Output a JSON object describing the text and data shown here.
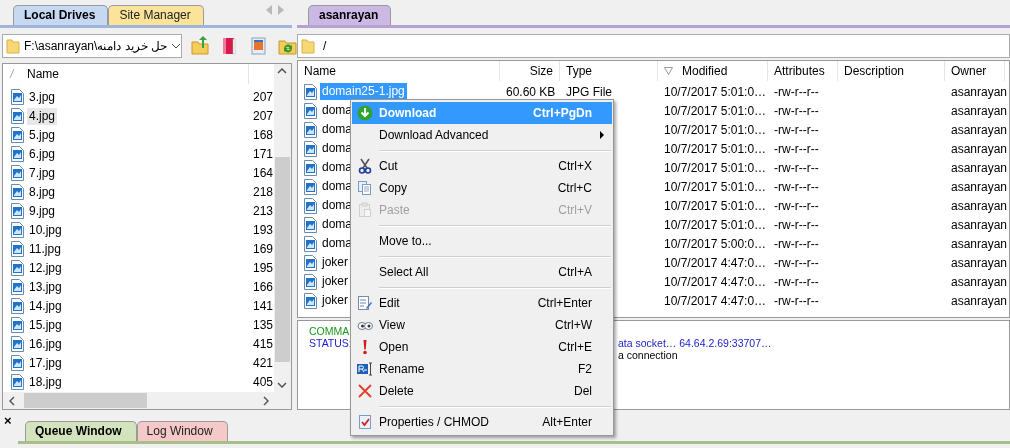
{
  "local": {
    "tabs": [
      {
        "label": "Local Drives",
        "selected": true,
        "color": "#c6d8f2"
      },
      {
        "label": "Site Manager",
        "selected": false,
        "color": "#fbe39a"
      }
    ],
    "path": "F:\\asanrayan\\حل خرید دامنه",
    "columns": [
      "Name"
    ],
    "files": [
      {
        "name": "3.jpg",
        "size": "207",
        "selected": false
      },
      {
        "name": "4.jpg",
        "size": "207",
        "selected": true
      },
      {
        "name": "5.jpg",
        "size": "168",
        "selected": false
      },
      {
        "name": "6.jpg",
        "size": "171",
        "selected": false
      },
      {
        "name": "7.jpg",
        "size": "164",
        "selected": false
      },
      {
        "name": "8.jpg",
        "size": "218",
        "selected": false
      },
      {
        "name": "9.jpg",
        "size": "213",
        "selected": false
      },
      {
        "name": "10.jpg",
        "size": "193",
        "selected": false
      },
      {
        "name": "11.jpg",
        "size": "169",
        "selected": false
      },
      {
        "name": "12.jpg",
        "size": "195",
        "selected": false
      },
      {
        "name": "13.jpg",
        "size": "166",
        "selected": false
      },
      {
        "name": "14.jpg",
        "size": "141",
        "selected": false
      },
      {
        "name": "15.jpg",
        "size": "135",
        "selected": false
      },
      {
        "name": "16.jpg",
        "size": "415",
        "selected": false
      },
      {
        "name": "17.jpg",
        "size": "421",
        "selected": false
      },
      {
        "name": "18.jpg",
        "size": "405",
        "selected": false
      }
    ]
  },
  "remote": {
    "tabs": [
      {
        "label": "asanrayan",
        "selected": true,
        "color": "#cbb8e4"
      }
    ],
    "path": "/",
    "columns": [
      "Name",
      "Size",
      "Type",
      "Modified",
      "Attributes",
      "Description",
      "Owner"
    ],
    "files": [
      {
        "name": "domain25-1.jpg",
        "size": "60.60 KB",
        "type": "JPG File",
        "modified": "10/7/2017 5:01:0…",
        "attributes": "-rw-r--r--",
        "owner": "asanrayan",
        "selected": true
      },
      {
        "name": "doma",
        "modified": "10/7/2017 5:01:0…",
        "attributes": "-rw-r--r--",
        "owner": "asanrayan",
        "selected": false
      },
      {
        "name": "doma",
        "modified": "10/7/2017 5:01:0…",
        "attributes": "-rw-r--r--",
        "owner": "asanrayan",
        "selected": false
      },
      {
        "name": "doma",
        "modified": "10/7/2017 5:01:0…",
        "attributes": "-rw-r--r--",
        "owner": "asanrayan",
        "selected": false
      },
      {
        "name": "doma",
        "modified": "10/7/2017 5:01:0…",
        "attributes": "-rw-r--r--",
        "owner": "asanrayan",
        "selected": false
      },
      {
        "name": "doma",
        "modified": "10/7/2017 5:01:0…",
        "attributes": "-rw-r--r--",
        "owner": "asanrayan",
        "selected": false
      },
      {
        "name": "doma",
        "modified": "10/7/2017 5:01:0…",
        "attributes": "-rw-r--r--",
        "owner": "asanrayan",
        "selected": false
      },
      {
        "name": "doma",
        "modified": "10/7/2017 5:01:0…",
        "attributes": "-rw-r--r--",
        "owner": "asanrayan",
        "selected": false
      },
      {
        "name": "doma",
        "modified": "10/7/2017 5:00:0…",
        "attributes": "-rw-r--r--",
        "owner": "asanrayan",
        "selected": false
      },
      {
        "name": "joker",
        "modified": "10/7/2017 4:47:0…",
        "attributes": "-rw-r--r--",
        "owner": "asanrayan",
        "selected": false
      },
      {
        "name": "joker",
        "modified": "10/7/2017 4:47:0…",
        "attributes": "-rw-r--r--",
        "owner": "asanrayan",
        "selected": false
      },
      {
        "name": "joker",
        "modified": "10/7/2017 4:47:0…",
        "attributes": "-rw-r--r--",
        "owner": "asanrayan",
        "selected": false
      }
    ]
  },
  "log": [
    {
      "kind": "command",
      "text": "COMMA"
    },
    {
      "kind": "status",
      "text": "STATUS:",
      "tail": "ata socket… 64.64.2.69:33707…"
    },
    {
      "kind": "plain",
      "tail": "a connection"
    }
  ],
  "context_menu": [
    {
      "kind": "item",
      "label": "Download",
      "shortcut": "Ctrl+PgDn",
      "selected": true,
      "disabled": false,
      "submenu": false
    },
    {
      "kind": "item",
      "label": "Download Advanced",
      "selected": false,
      "disabled": false,
      "submenu": true
    },
    {
      "kind": "separator"
    },
    {
      "kind": "item",
      "label": "Cut",
      "shortcut": "Ctrl+X",
      "selected": false,
      "disabled": false,
      "submenu": false
    },
    {
      "kind": "item",
      "label": "Copy",
      "shortcut": "Ctrl+C",
      "selected": false,
      "disabled": false,
      "submenu": false
    },
    {
      "kind": "item",
      "label": "Paste",
      "shortcut": "Ctrl+V",
      "selected": false,
      "disabled": true,
      "submenu": false
    },
    {
      "kind": "separator"
    },
    {
      "kind": "item",
      "label": "Move to...",
      "selected": false,
      "disabled": false,
      "submenu": false
    },
    {
      "kind": "separator"
    },
    {
      "kind": "item",
      "label": "Select All",
      "shortcut": "Ctrl+A",
      "selected": false,
      "disabled": false,
      "submenu": false
    },
    {
      "kind": "separator"
    },
    {
      "kind": "item",
      "label": "Edit",
      "shortcut": "Ctrl+Enter",
      "selected": false,
      "disabled": false,
      "submenu": false
    },
    {
      "kind": "item",
      "label": "View",
      "shortcut": "Ctrl+W",
      "selected": false,
      "disabled": false,
      "submenu": false
    },
    {
      "kind": "item",
      "label": "Open",
      "shortcut": "Ctrl+E",
      "selected": false,
      "disabled": false,
      "submenu": false
    },
    {
      "kind": "item",
      "label": "Rename",
      "shortcut": "F2",
      "selected": false,
      "disabled": false,
      "submenu": false
    },
    {
      "kind": "item",
      "label": "Delete",
      "shortcut": "Del",
      "selected": false,
      "disabled": false,
      "submenu": false
    },
    {
      "kind": "separator"
    },
    {
      "kind": "item",
      "label": "Properties / CHMOD",
      "shortcut": "Alt+Enter",
      "selected": false,
      "disabled": false,
      "submenu": false
    }
  ],
  "bottom_tabs": [
    {
      "label": "Queue Window",
      "selected": true,
      "color": "#d3e3bd"
    },
    {
      "label": "Log Window",
      "selected": false,
      "color": "#f6c9c9"
    }
  ],
  "close": "×"
}
